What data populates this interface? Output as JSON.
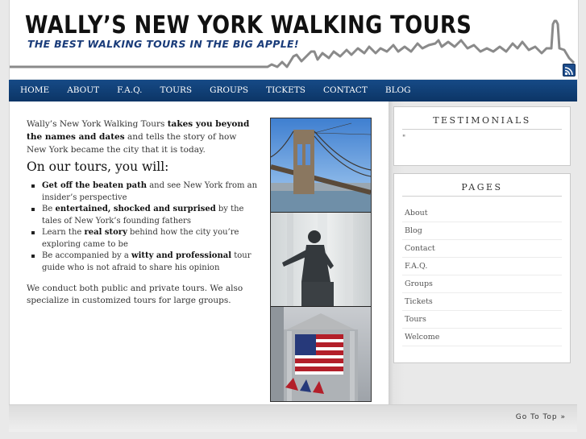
{
  "header": {
    "title": "WALLY’S NEW YORK WALKING TOURS",
    "tagline": "THE BEST WALKING TOURS IN THE BIG APPLE!"
  },
  "nav": {
    "items": [
      "HOME",
      "ABOUT",
      "F.A.Q.",
      "TOURS",
      "GROUPS",
      "TICKETS",
      "CONTACT",
      "BLOG"
    ]
  },
  "content": {
    "intro": {
      "part1": "Wally’s New York Walking Tours ",
      "bold": "takes you beyond the names and dates",
      "part2": " and tells the story of how New York became the city that it is today."
    },
    "heading": "On our tours, you will:",
    "features": [
      {
        "pre": "",
        "bold": "Get off the beaten path",
        "post": " and see New York from an insider’s perspective"
      },
      {
        "pre": "Be ",
        "bold": "entertained, shocked and surprised",
        "post": " by the tales of New York’s founding fathers"
      },
      {
        "pre": "Learn the ",
        "bold": "real story",
        "post": " behind how the city you’re exploring came to be"
      },
      {
        "pre": "Be accompanied by a ",
        "bold": "witty and professional",
        "post": " tour guide who is not afraid to share his opinion"
      }
    ],
    "outro": "We conduct both public and private tours. We also specialize in customized tours for large groups."
  },
  "sidebar": {
    "testimonials_title": "TESTIMONIALS",
    "testimonials_placeholder": "\"",
    "pages_title": "PAGES",
    "pages": [
      "About",
      "Blog",
      "Contact",
      "F.A.Q.",
      "Groups",
      "Tickets",
      "Tours",
      "Welcome"
    ]
  },
  "footer": {
    "go_top": "Go To Top »"
  },
  "colors": {
    "nav_bg": "#0c3566",
    "tagline": "#1a3c7a",
    "rss": "#1d4d8c"
  },
  "icons": {
    "rss": "rss-icon"
  }
}
